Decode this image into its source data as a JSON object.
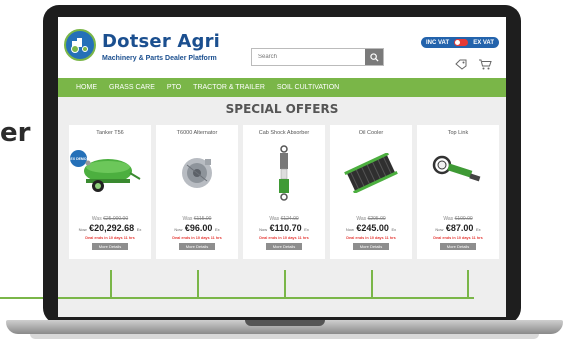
{
  "slide": {
    "left_text": "er"
  },
  "header": {
    "brand": "Dotser Agri",
    "tagline": "Machinery & Parts Dealer Platform",
    "search_placeholder": "Search",
    "vat_inc": "INC VAT",
    "vat_ex": "EX VAT"
  },
  "nav": {
    "items": [
      "HOME",
      "GRASS CARE",
      "PTO",
      "TRACTOR & TRAILER",
      "SOIL CULTIVATION"
    ]
  },
  "offers": {
    "title": "SPECIAL OFFERS",
    "ex_badge": "EX DEMO",
    "details_label": "More Details",
    "products": [
      {
        "name": "Tanker T56",
        "was_label": "Was",
        "was": "€25,000.00",
        "now_label": "Now",
        "now": "€20,292.68",
        "vat": "Ex",
        "deal": "Deal ends in 10 days 11 hrs"
      },
      {
        "name": "T6000 Alternator",
        "was_label": "Was",
        "was": "€115.00",
        "now_label": "Now",
        "now": "€96.00",
        "vat": "Ex",
        "deal": "Deal ends in 10 days 11 hrs"
      },
      {
        "name": "Cab Shock Absorber",
        "was_label": "Was",
        "was": "€124.00",
        "now_label": "Now",
        "now": "€110.70",
        "vat": "Ex",
        "deal": "Deal ends in 10 days 11 hrs"
      },
      {
        "name": "Oil Cooler",
        "was_label": "Was",
        "was": "€295.00",
        "now_label": "Now",
        "now": "€245.00",
        "vat": "Ex",
        "deal": "Deal ends in 10 days 11 hrs"
      },
      {
        "name": "Top Link",
        "was_label": "Was",
        "was": "€100.00",
        "now_label": "Now",
        "now": "€87.00",
        "vat": "Ex",
        "deal": "Deal ends in 10 days 11 hrs"
      }
    ]
  },
  "colors": {
    "brand_blue": "#1b4f8f",
    "accent_green": "#7ab648",
    "deal_red": "#e53935"
  }
}
